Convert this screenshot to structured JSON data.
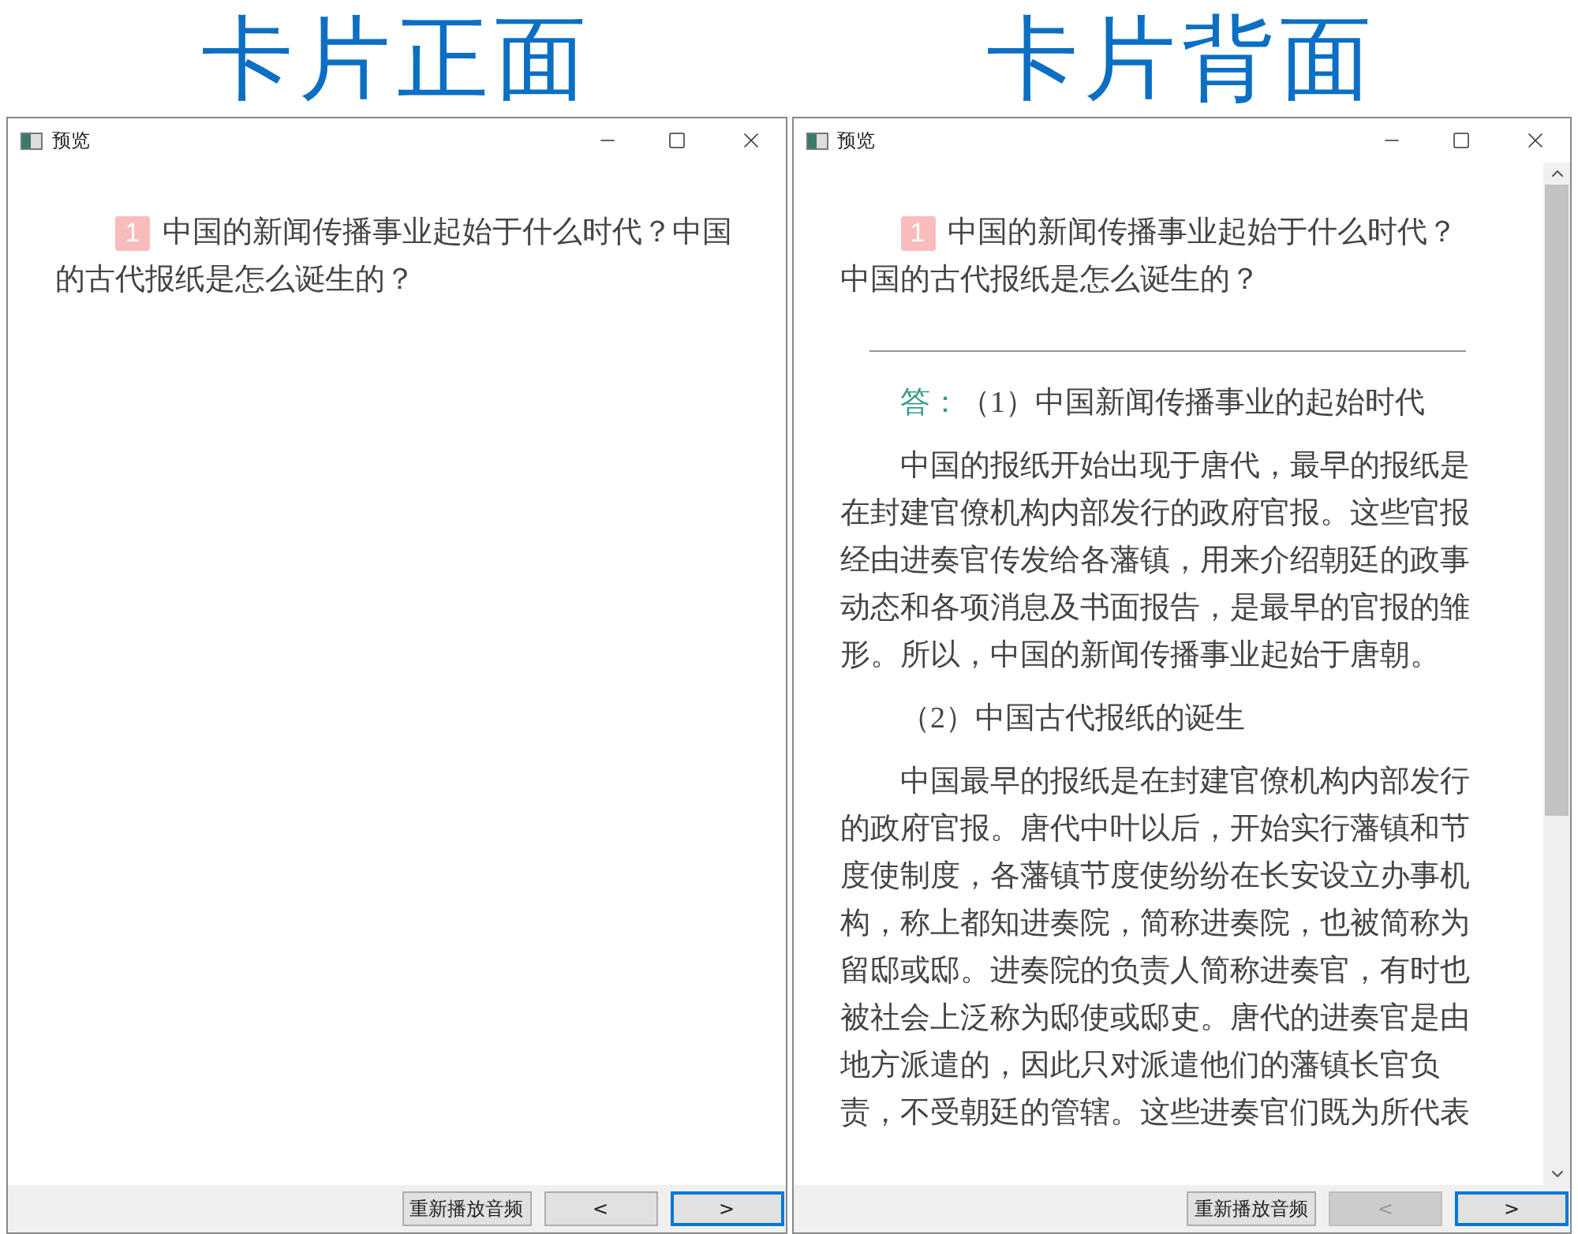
{
  "windows": [
    {
      "heading": "卡片正面",
      "title": "预览",
      "scrollable": false,
      "question": {
        "number": "1",
        "text": "中国的新闻传播事业起始于什么时代？中国的古代报纸是怎么诞生的？"
      },
      "buttons": [
        {
          "kind": "text",
          "label": "重新播放音频",
          "disabled": false,
          "focused": false
        },
        {
          "kind": "prev",
          "label": "<",
          "disabled": false,
          "focused": false
        },
        {
          "kind": "next",
          "label": ">",
          "disabled": false,
          "focused": true
        }
      ]
    },
    {
      "heading": "卡片背面",
      "title": "预览",
      "scrollable": true,
      "question": {
        "number": "1",
        "text": "中国的新闻传播事业起始于什么时代？中国的古代报纸是怎么诞生的？"
      },
      "answer": [
        {
          "kind": "heading",
          "marker": "答：",
          "text": "（1）中国新闻传播事业的起始时代"
        },
        {
          "kind": "body",
          "text": "中国的报纸开始出现于唐代，最早的报纸是在封建官僚机构内部发行的政府官报。这些官报经由进奏官传发给各藩镇，用来介绍朝廷的政事动态和各项消息及书面报告，是最早的官报的雏形。所以，中国的新闻传播事业起始于唐朝。"
        },
        {
          "kind": "heading",
          "text": "（2）中国古代报纸的诞生"
        },
        {
          "kind": "body",
          "text": "中国最早的报纸是在封建官僚机构内部发行的政府官报。唐代中叶以后，开始实行藩镇和节度使制度，各藩镇节度使纷纷在长安设立办事机构，称上都知进奏院，简称进奏院，也被简称为留邸或邸。进奏院的负责人简称进奏官，有时也被社会上泛称为邸使或邸吏。唐代的进奏官是由地方派遣的，因此只对派遣他们的藩镇长官负责，不受朝廷的管辖。这些进奏官们既为所代表"
        }
      ],
      "buttons": [
        {
          "kind": "text",
          "label": "重新播放音频",
          "disabled": false,
          "focused": false
        },
        {
          "kind": "prev",
          "label": "<",
          "disabled": true,
          "focused": false
        },
        {
          "kind": "next",
          "label": ">",
          "disabled": false,
          "focused": true
        }
      ]
    }
  ]
}
